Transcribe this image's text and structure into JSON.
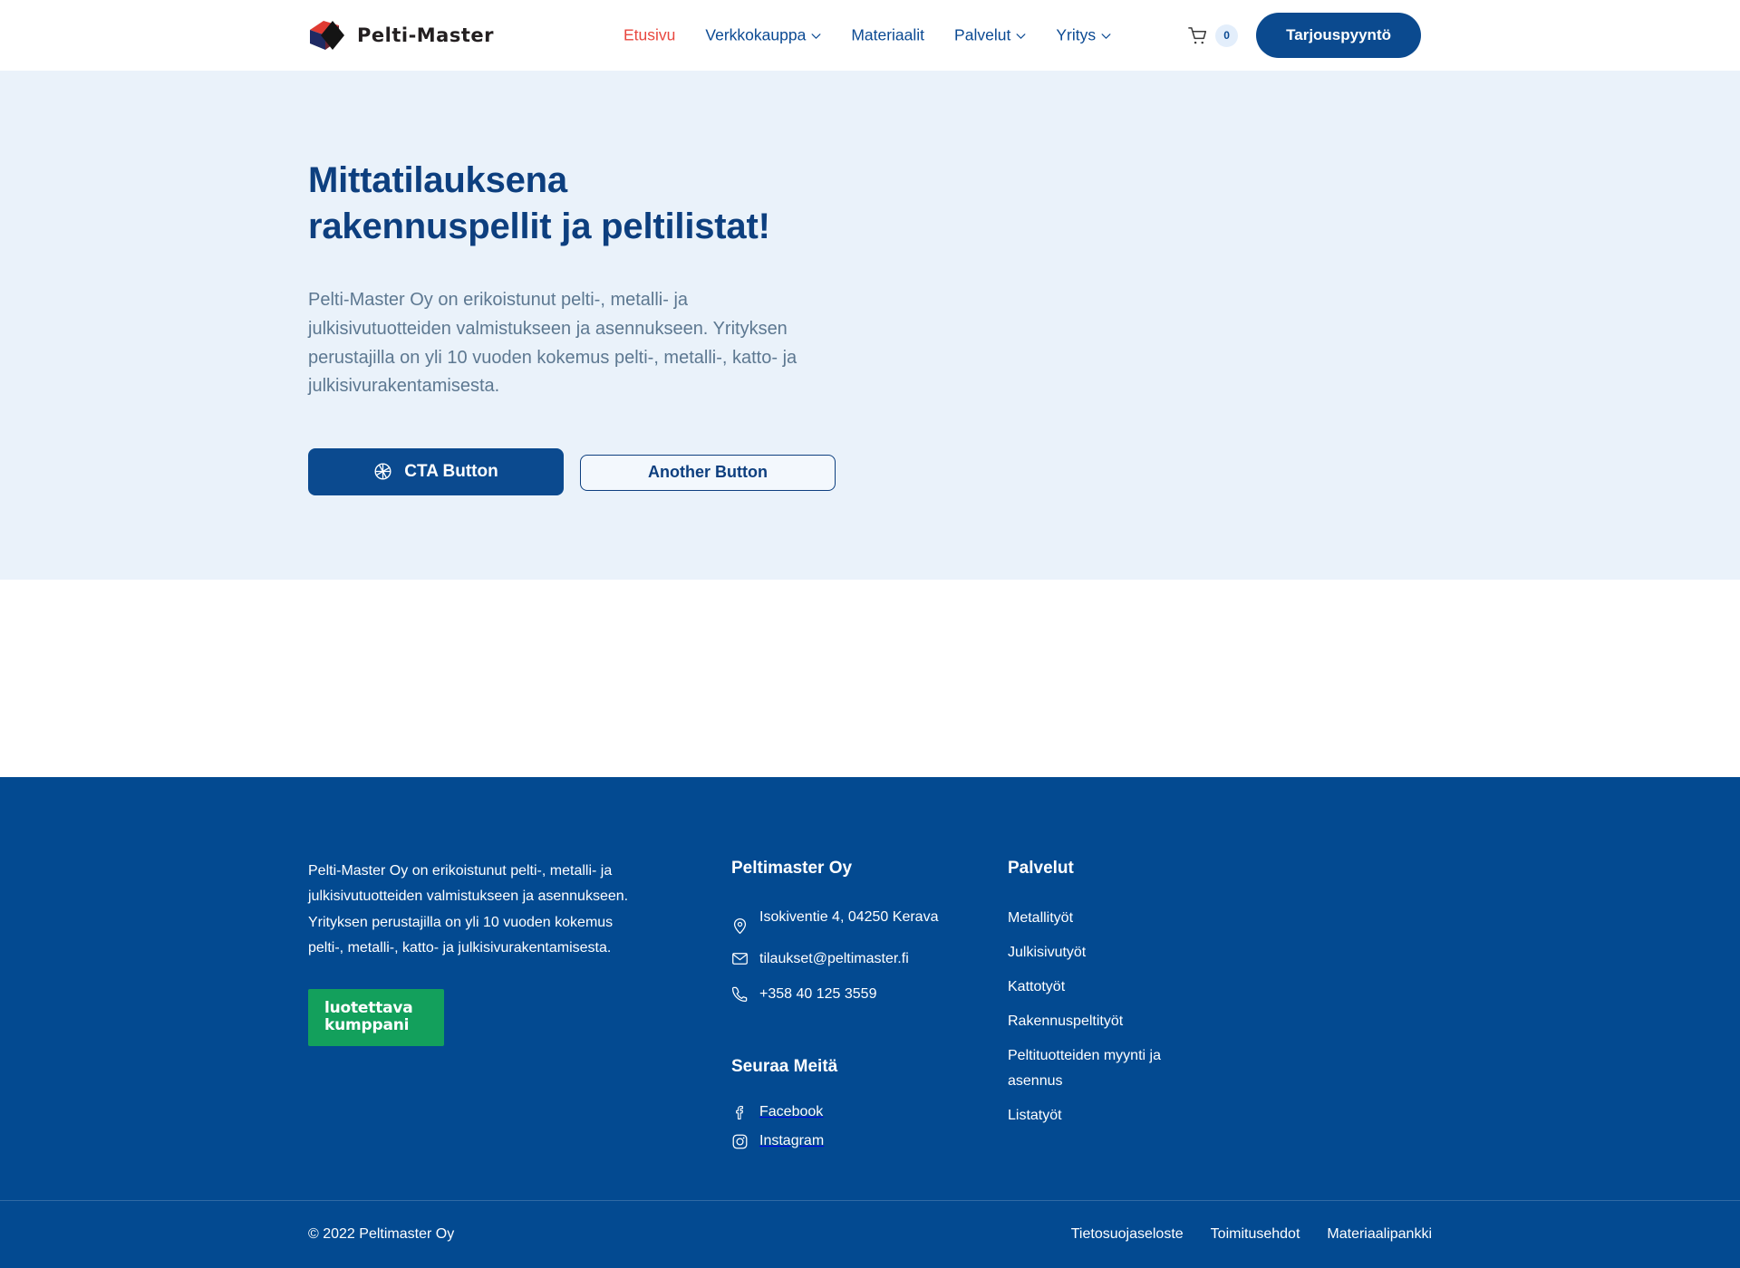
{
  "brand": {
    "name": "Pelti-Master",
    "logo_icon": "pelti-master-cube-logo",
    "colors": {
      "primary_blue": "#0b4a8f",
      "footer_blue": "#034a91",
      "heading_blue": "#0d3f7f",
      "hero_bg": "#eaf2fa",
      "accent_red": "#e8473f",
      "trust_green": "#13a05c"
    }
  },
  "header": {
    "nav": [
      {
        "label": "Etusivu",
        "has_caret": false,
        "active": true
      },
      {
        "label": "Verkkokauppa",
        "has_caret": true,
        "active": false
      },
      {
        "label": "Materiaalit",
        "has_caret": false,
        "active": false
      },
      {
        "label": "Palvelut",
        "has_caret": true,
        "active": false
      },
      {
        "label": "Yritys",
        "has_caret": true,
        "active": false
      }
    ],
    "cart": {
      "icon": "shopping-cart-icon",
      "count": "0"
    },
    "cta_label": "Tarjouspyyntö"
  },
  "hero": {
    "heading_line1": "Mittatilauksena",
    "heading_line2": "rakennuspellit ja peltilistat!",
    "paragraph": "Pelti-Master Oy on erikoistunut pelti-, metalli- ja julkisivutuotteiden valmistukseen ja asennukseen. Yrityksen perustajilla on yli 10 vuoden kokemus pelti-, metalli-, katto- ja julkisivurakentamisesta.",
    "primary_button": {
      "label": "CTA Button",
      "icon": "aperture-icon"
    },
    "secondary_button": {
      "label": "Another Button"
    }
  },
  "footer": {
    "about_text": "Pelti-Master Oy on erikoistunut pelti-, metalli- ja julkisivutuotteiden valmistukseen ja asennukseen. Yrityksen perustajilla on yli 10 vuoden kokemus pelti-, metalli-, katto- ja julkisivurakentamisesta.",
    "trust_badge": {
      "line1": "luotettava",
      "line2": "kumppani"
    },
    "contact": {
      "heading": "Peltimaster Oy",
      "address": "Isokiventie 4, 04250 Kerava",
      "email": "tilaukset@peltimaster.fi",
      "phone": "+358 40 125 3559"
    },
    "social": {
      "heading": "Seuraa Meitä",
      "items": [
        {
          "label": "Facebook",
          "icon": "facebook-icon"
        },
        {
          "label": "Instagram",
          "icon": "instagram-icon"
        }
      ]
    },
    "services": {
      "heading": "Palvelut",
      "items": [
        "Metallityöt",
        "Julkisivutyöt",
        "Kattotyöt",
        "Rakennuspeltityöt",
        "Peltituotteiden myynti ja asennus",
        "Listatyöt"
      ]
    },
    "copyright": "© 2022 Peltimaster Oy",
    "legal_links": [
      "Tietosuojaseloste",
      "Toimitusehdot",
      "Materiaalipankki"
    ]
  }
}
